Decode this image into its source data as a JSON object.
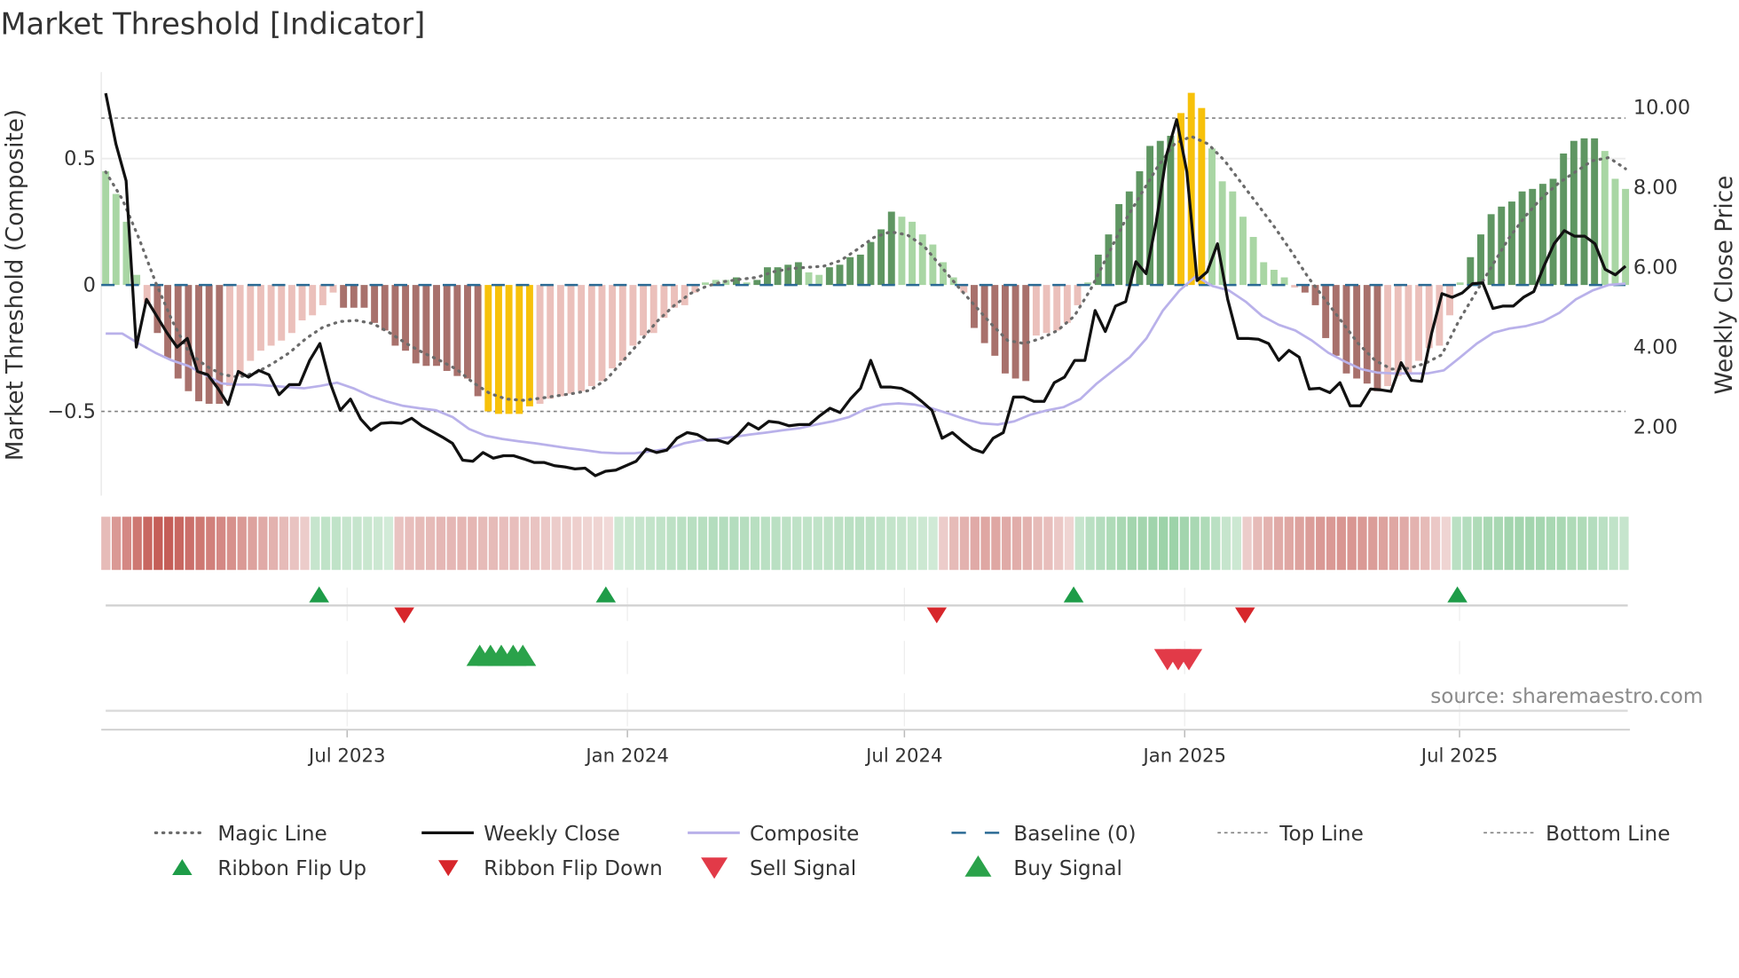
{
  "chart_data": {
    "type": "bar",
    "title": "Market Threshold [Indicator]",
    "ylabel_left": "Market Threshold (Composite)",
    "ylabel_right": "Weekly Close Price",
    "x_unit": "week index",
    "x_range": [
      0,
      141
    ],
    "ylim_left": [
      -0.85,
      0.85
    ],
    "ylim_right": [
      0.3,
      10.8
    ],
    "left_ticks": [
      {
        "v": 0.5,
        "label": "0.5"
      },
      {
        "v": 0,
        "label": "0"
      },
      {
        "v": -0.5,
        "label": "−0.5"
      }
    ],
    "right_ticks": [
      {
        "v": 10,
        "label": "10.00"
      },
      {
        "v": 8,
        "label": "8.00"
      },
      {
        "v": 6,
        "label": "6.00"
      },
      {
        "v": 4,
        "label": "4.00"
      },
      {
        "v": 2,
        "label": "2.00"
      }
    ],
    "x_ticks": [
      {
        "week": 22.4,
        "label": "Jul 2023"
      },
      {
        "week": 48.4,
        "label": "Jan 2024"
      },
      {
        "week": 74.1,
        "label": "Jul 2024"
      },
      {
        "week": 100.1,
        "label": "Jan 2025"
      },
      {
        "week": 125.6,
        "label": "Jul 2025"
      }
    ],
    "top_line": 0.66,
    "bottom_line": -0.5,
    "baseline": 0,
    "bar_colors": {
      "L": "#a9d6a4",
      "G": "#5f9662",
      "P": "#ebc0bb",
      "R": "#a8716c",
      "Y": "#f7c10a"
    },
    "composite_bars": [
      [
        0.45,
        "L"
      ],
      [
        0.36,
        "L"
      ],
      [
        0.25,
        "L"
      ],
      [
        0.04,
        "L"
      ],
      [
        -0.07,
        "P"
      ],
      [
        -0.19,
        "R"
      ],
      [
        -0.29,
        "R"
      ],
      [
        -0.37,
        "R"
      ],
      [
        -0.42,
        "R"
      ],
      [
        -0.46,
        "R"
      ],
      [
        -0.47,
        "R"
      ],
      [
        -0.47,
        "R"
      ],
      [
        -0.4,
        "P"
      ],
      [
        -0.36,
        "P"
      ],
      [
        -0.3,
        "P"
      ],
      [
        -0.26,
        "P"
      ],
      [
        -0.24,
        "P"
      ],
      [
        -0.22,
        "P"
      ],
      [
        -0.19,
        "P"
      ],
      [
        -0.14,
        "P"
      ],
      [
        -0.12,
        "P"
      ],
      [
        -0.08,
        "P"
      ],
      [
        -0.03,
        "P"
      ],
      [
        -0.09,
        "R"
      ],
      [
        -0.09,
        "R"
      ],
      [
        -0.09,
        "R"
      ],
      [
        -0.15,
        "R"
      ],
      [
        -0.18,
        "R"
      ],
      [
        -0.24,
        "R"
      ],
      [
        -0.26,
        "R"
      ],
      [
        -0.31,
        "R"
      ],
      [
        -0.32,
        "R"
      ],
      [
        -0.32,
        "R"
      ],
      [
        -0.34,
        "R"
      ],
      [
        -0.36,
        "R"
      ],
      [
        -0.37,
        "R"
      ],
      [
        -0.44,
        "R"
      ],
      [
        -0.5,
        "Y"
      ],
      [
        -0.51,
        "Y"
      ],
      [
        -0.51,
        "Y"
      ],
      [
        -0.51,
        "Y"
      ],
      [
        -0.48,
        "Y"
      ],
      [
        -0.47,
        "P"
      ],
      [
        -0.45,
        "P"
      ],
      [
        -0.44,
        "P"
      ],
      [
        -0.43,
        "P"
      ],
      [
        -0.42,
        "P"
      ],
      [
        -0.4,
        "P"
      ],
      [
        -0.38,
        "P"
      ],
      [
        -0.33,
        "P"
      ],
      [
        -0.3,
        "P"
      ],
      [
        -0.24,
        "P"
      ],
      [
        -0.2,
        "P"
      ],
      [
        -0.19,
        "P"
      ],
      [
        -0.13,
        "P"
      ],
      [
        -0.09,
        "P"
      ],
      [
        -0.08,
        "P"
      ],
      [
        -0.03,
        "P"
      ],
      [
        0.01,
        "L"
      ],
      [
        0.02,
        "L"
      ],
      [
        0.02,
        "L"
      ],
      [
        0.03,
        "G"
      ],
      [
        0.01,
        "L"
      ],
      [
        0.02,
        "G"
      ],
      [
        0.07,
        "G"
      ],
      [
        0.07,
        "G"
      ],
      [
        0.08,
        "G"
      ],
      [
        0.09,
        "G"
      ],
      [
        0.05,
        "L"
      ],
      [
        0.04,
        "L"
      ],
      [
        0.07,
        "G"
      ],
      [
        0.08,
        "G"
      ],
      [
        0.11,
        "G"
      ],
      [
        0.12,
        "G"
      ],
      [
        0.17,
        "G"
      ],
      [
        0.22,
        "G"
      ],
      [
        0.29,
        "G"
      ],
      [
        0.27,
        "L"
      ],
      [
        0.25,
        "L"
      ],
      [
        0.2,
        "L"
      ],
      [
        0.16,
        "L"
      ],
      [
        0.09,
        "L"
      ],
      [
        0.03,
        "L"
      ],
      [
        -0.03,
        "P"
      ],
      [
        -0.17,
        "R"
      ],
      [
        -0.23,
        "R"
      ],
      [
        -0.28,
        "R"
      ],
      [
        -0.35,
        "R"
      ],
      [
        -0.37,
        "R"
      ],
      [
        -0.38,
        "R"
      ],
      [
        -0.2,
        "P"
      ],
      [
        -0.19,
        "P"
      ],
      [
        -0.18,
        "P"
      ],
      [
        -0.15,
        "P"
      ],
      [
        -0.08,
        "P"
      ],
      [
        0.01,
        "L"
      ],
      [
        0.12,
        "G"
      ],
      [
        0.2,
        "G"
      ],
      [
        0.32,
        "G"
      ],
      [
        0.37,
        "G"
      ],
      [
        0.45,
        "G"
      ],
      [
        0.55,
        "G"
      ],
      [
        0.57,
        "G"
      ],
      [
        0.59,
        "G"
      ],
      [
        0.68,
        "Y"
      ],
      [
        0.76,
        "Y"
      ],
      [
        0.7,
        "Y"
      ],
      [
        0.54,
        "L"
      ],
      [
        0.41,
        "L"
      ],
      [
        0.37,
        "L"
      ],
      [
        0.27,
        "L"
      ],
      [
        0.19,
        "L"
      ],
      [
        0.09,
        "L"
      ],
      [
        0.06,
        "L"
      ],
      [
        0.03,
        "L"
      ],
      [
        -0.01,
        "P"
      ],
      [
        -0.03,
        "R"
      ],
      [
        -0.08,
        "R"
      ],
      [
        -0.21,
        "R"
      ],
      [
        -0.28,
        "R"
      ],
      [
        -0.35,
        "R"
      ],
      [
        -0.37,
        "R"
      ],
      [
        -0.39,
        "R"
      ],
      [
        -0.42,
        "R"
      ],
      [
        -0.4,
        "P"
      ],
      [
        -0.36,
        "P"
      ],
      [
        -0.35,
        "P"
      ],
      [
        -0.3,
        "P"
      ],
      [
        -0.25,
        "P"
      ],
      [
        -0.24,
        "P"
      ],
      [
        -0.12,
        "P"
      ],
      [
        0.01,
        "L"
      ],
      [
        0.11,
        "G"
      ],
      [
        0.2,
        "G"
      ],
      [
        0.28,
        "G"
      ],
      [
        0.31,
        "G"
      ],
      [
        0.33,
        "G"
      ],
      [
        0.37,
        "G"
      ],
      [
        0.38,
        "G"
      ],
      [
        0.4,
        "G"
      ],
      [
        0.42,
        "G"
      ],
      [
        0.52,
        "G"
      ],
      [
        0.57,
        "G"
      ],
      [
        0.58,
        "G"
      ],
      [
        0.58,
        "G"
      ],
      [
        0.53,
        "L"
      ],
      [
        0.42,
        "L"
      ],
      [
        0.38,
        "L"
      ]
    ],
    "weekly_close": [
      10.33,
      9.06,
      8.14,
      3.97,
      5.17,
      4.75,
      4.33,
      3.97,
      4.19,
      3.36,
      3.28,
      2.94,
      2.53,
      3.36,
      3.22,
      3.39,
      3.28,
      2.78,
      3.03,
      3.03,
      3.64,
      4.06,
      3.08,
      2.39,
      2.67,
      2.17,
      1.89,
      2.06,
      2.08,
      2.06,
      2.19,
      2.0,
      1.86,
      1.72,
      1.56,
      1.14,
      1.11,
      1.33,
      1.19,
      1.25,
      1.25,
      1.17,
      1.08,
      1.08,
      1.0,
      0.97,
      0.92,
      0.94,
      0.75,
      0.86,
      0.89,
      1.0,
      1.11,
      1.42,
      1.33,
      1.39,
      1.69,
      1.83,
      1.78,
      1.64,
      1.64,
      1.56,
      1.78,
      2.06,
      1.92,
      2.11,
      2.08,
      2.0,
      2.03,
      2.03,
      2.25,
      2.44,
      2.33,
      2.67,
      2.94,
      3.64,
      2.97,
      2.97,
      2.94,
      2.81,
      2.61,
      2.39,
      1.69,
      1.83,
      1.61,
      1.42,
      1.33,
      1.69,
      1.83,
      2.72,
      2.72,
      2.61,
      2.61,
      3.08,
      3.22,
      3.64,
      3.64,
      4.89,
      4.36,
      5.0,
      5.11,
      6.11,
      5.81,
      7.11,
      8.78,
      9.67,
      8.36,
      5.64,
      5.86,
      6.56,
      5.17,
      4.19,
      4.19,
      4.17,
      4.06,
      3.64,
      3.89,
      3.72,
      2.92,
      2.94,
      2.83,
      3.08,
      2.5,
      2.5,
      2.92,
      2.9,
      2.86,
      3.58,
      3.14,
      3.11,
      4.33,
      5.31,
      5.22,
      5.33,
      5.56,
      5.58,
      4.94,
      5.0,
      5.0,
      5.22,
      5.36,
      6.0,
      6.56,
      6.89,
      6.75,
      6.75,
      6.56,
      5.92,
      5.78,
      6.0
    ],
    "magic_line": [
      8.36,
      7.67,
      6.69,
      5.58,
      4.61,
      3.83,
      3.5,
      3.28,
      3.22,
      3.33,
      3.56,
      3.83,
      4.19,
      4.47,
      4.61,
      4.64,
      4.56,
      4.33,
      4.06,
      3.83,
      3.64,
      3.42,
      3.08,
      2.81,
      2.67,
      2.64,
      2.69,
      2.75,
      2.81,
      2.89,
      3.17,
      3.64,
      4.11,
      4.61,
      5.0,
      5.31,
      5.5,
      5.61,
      5.67,
      5.72,
      5.86,
      5.94,
      5.97,
      6.0,
      6.14,
      6.42,
      6.72,
      6.86,
      6.78,
      6.5,
      6.0,
      5.5,
      5.03,
      4.56,
      4.14,
      4.06,
      4.19,
      4.39,
      4.75,
      5.44,
      6.28,
      7.11,
      7.81,
      8.5,
      9.06,
      9.25,
      9.06,
      8.64,
      8.08,
      7.53,
      6.97,
      6.36,
      5.72,
      5.17,
      4.61,
      4.06,
      3.64,
      3.42,
      3.44,
      3.56,
      3.78,
      4.61,
      5.31,
      6.0,
      6.69,
      7.25,
      7.72,
      8.08,
      8.36,
      8.64,
      8.72,
      8.44
    ],
    "composite_line": [
      4.31,
      4.31,
      4.06,
      3.83,
      3.64,
      3.5,
      3.28,
      3.06,
      3.03,
      3.03,
      3.0,
      2.97,
      2.94,
      3.0,
      3.08,
      2.94,
      2.75,
      2.61,
      2.5,
      2.44,
      2.39,
      2.22,
      1.92,
      1.75,
      1.67,
      1.61,
      1.56,
      1.5,
      1.44,
      1.39,
      1.33,
      1.31,
      1.31,
      1.36,
      1.42,
      1.56,
      1.64,
      1.67,
      1.72,
      1.78,
      1.83,
      1.89,
      1.94,
      2.03,
      2.11,
      2.22,
      2.42,
      2.53,
      2.56,
      2.53,
      2.44,
      2.31,
      2.17,
      2.06,
      2.03,
      2.11,
      2.28,
      2.39,
      2.47,
      2.67,
      3.06,
      3.39,
      3.72,
      4.19,
      4.89,
      5.39,
      5.75,
      5.5,
      5.39,
      5.11,
      4.75,
      4.53,
      4.39,
      4.14,
      3.83,
      3.61,
      3.42,
      3.33,
      3.31,
      3.31,
      3.31,
      3.39,
      3.72,
      4.06,
      4.33,
      4.44,
      4.5,
      4.61,
      4.83,
      5.17,
      5.39,
      5.53,
      5.56
    ],
    "ribbon": [
      -0.3,
      -0.5,
      -0.6,
      -0.7,
      -0.8,
      -0.85,
      -0.85,
      -0.8,
      -0.75,
      -0.7,
      -0.65,
      -0.6,
      -0.55,
      -0.5,
      -0.45,
      -0.4,
      -0.35,
      -0.3,
      -0.25,
      -0.2,
      0.3,
      0.35,
      0.35,
      0.3,
      0.3,
      0.28,
      0.25,
      0.2,
      -0.25,
      -0.28,
      -0.3,
      -0.3,
      -0.32,
      -0.32,
      -0.33,
      -0.33,
      -0.3,
      -0.3,
      -0.28,
      -0.28,
      -0.25,
      -0.25,
      -0.22,
      -0.2,
      -0.2,
      -0.18,
      -0.15,
      -0.15,
      -0.12,
      0.25,
      0.28,
      0.3,
      0.33,
      0.35,
      0.38,
      0.4,
      0.42,
      0.43,
      0.45,
      0.45,
      0.45,
      0.44,
      0.42,
      0.4,
      0.4,
      0.38,
      0.36,
      0.35,
      0.35,
      0.36,
      0.38,
      0.4,
      0.4,
      0.38,
      0.35,
      0.33,
      0.3,
      0.28,
      0.25,
      0.22,
      -0.2,
      -0.3,
      -0.35,
      -0.4,
      -0.42,
      -0.42,
      -0.4,
      -0.38,
      -0.35,
      -0.3,
      -0.28,
      -0.22,
      -0.15,
      0.3,
      0.4,
      0.45,
      0.5,
      0.55,
      0.6,
      0.6,
      0.62,
      0.65,
      0.65,
      0.6,
      0.55,
      0.5,
      0.4,
      0.3,
      0.25,
      -0.2,
      -0.3,
      -0.35,
      -0.4,
      -0.42,
      -0.45,
      -0.48,
      -0.5,
      -0.5,
      -0.52,
      -0.52,
      -0.5,
      -0.48,
      -0.45,
      -0.42,
      -0.4,
      -0.35,
      -0.3,
      -0.22,
      -0.15,
      0.4,
      0.45,
      0.5,
      0.55,
      0.55,
      0.6,
      0.6,
      0.6,
      0.58,
      0.55,
      0.55,
      0.5,
      0.5,
      0.45,
      0.4,
      0.35,
      0.3
    ],
    "ribbon_flip_up": [
      19.8,
      46.4,
      89.8,
      125.4
    ],
    "ribbon_flip_down": [
      27.7,
      77.1,
      105.7
    ],
    "buy_signals": [
      34.7,
      35.7,
      36.7,
      37.8,
      38.7
    ],
    "sell_signals": [
      98.5,
      99.5,
      100.5
    ],
    "colors": {
      "close": "#111111",
      "magic": "#6b6b6b",
      "composite": "#b9b1ea",
      "baseline": "#2b6a94",
      "ref": "#808080",
      "up": "#1e9c48",
      "down": "#d7262b",
      "sell": "#e23a48",
      "buy": "#2aa24a",
      "ribbon_red": "#bf4e47",
      "ribbon_green": "#73c084"
    },
    "legend": [
      {
        "label": "Magic Line",
        "kind": "magic"
      },
      {
        "label": "Weekly Close",
        "kind": "close"
      },
      {
        "label": "Composite",
        "kind": "composite"
      },
      {
        "label": "Baseline (0)",
        "kind": "baseline"
      },
      {
        "label": "Top Line",
        "kind": "ref"
      },
      {
        "label": "Bottom Line",
        "kind": "ref"
      },
      {
        "label": "Ribbon Flip Up",
        "kind": "up"
      },
      {
        "label": "Ribbon Flip Down",
        "kind": "down"
      },
      {
        "label": "Sell Signal",
        "kind": "sell"
      },
      {
        "label": "Buy Signal",
        "kind": "buy"
      }
    ],
    "legend_placement": "bottom",
    "source": "source: sharemaestro.com"
  }
}
